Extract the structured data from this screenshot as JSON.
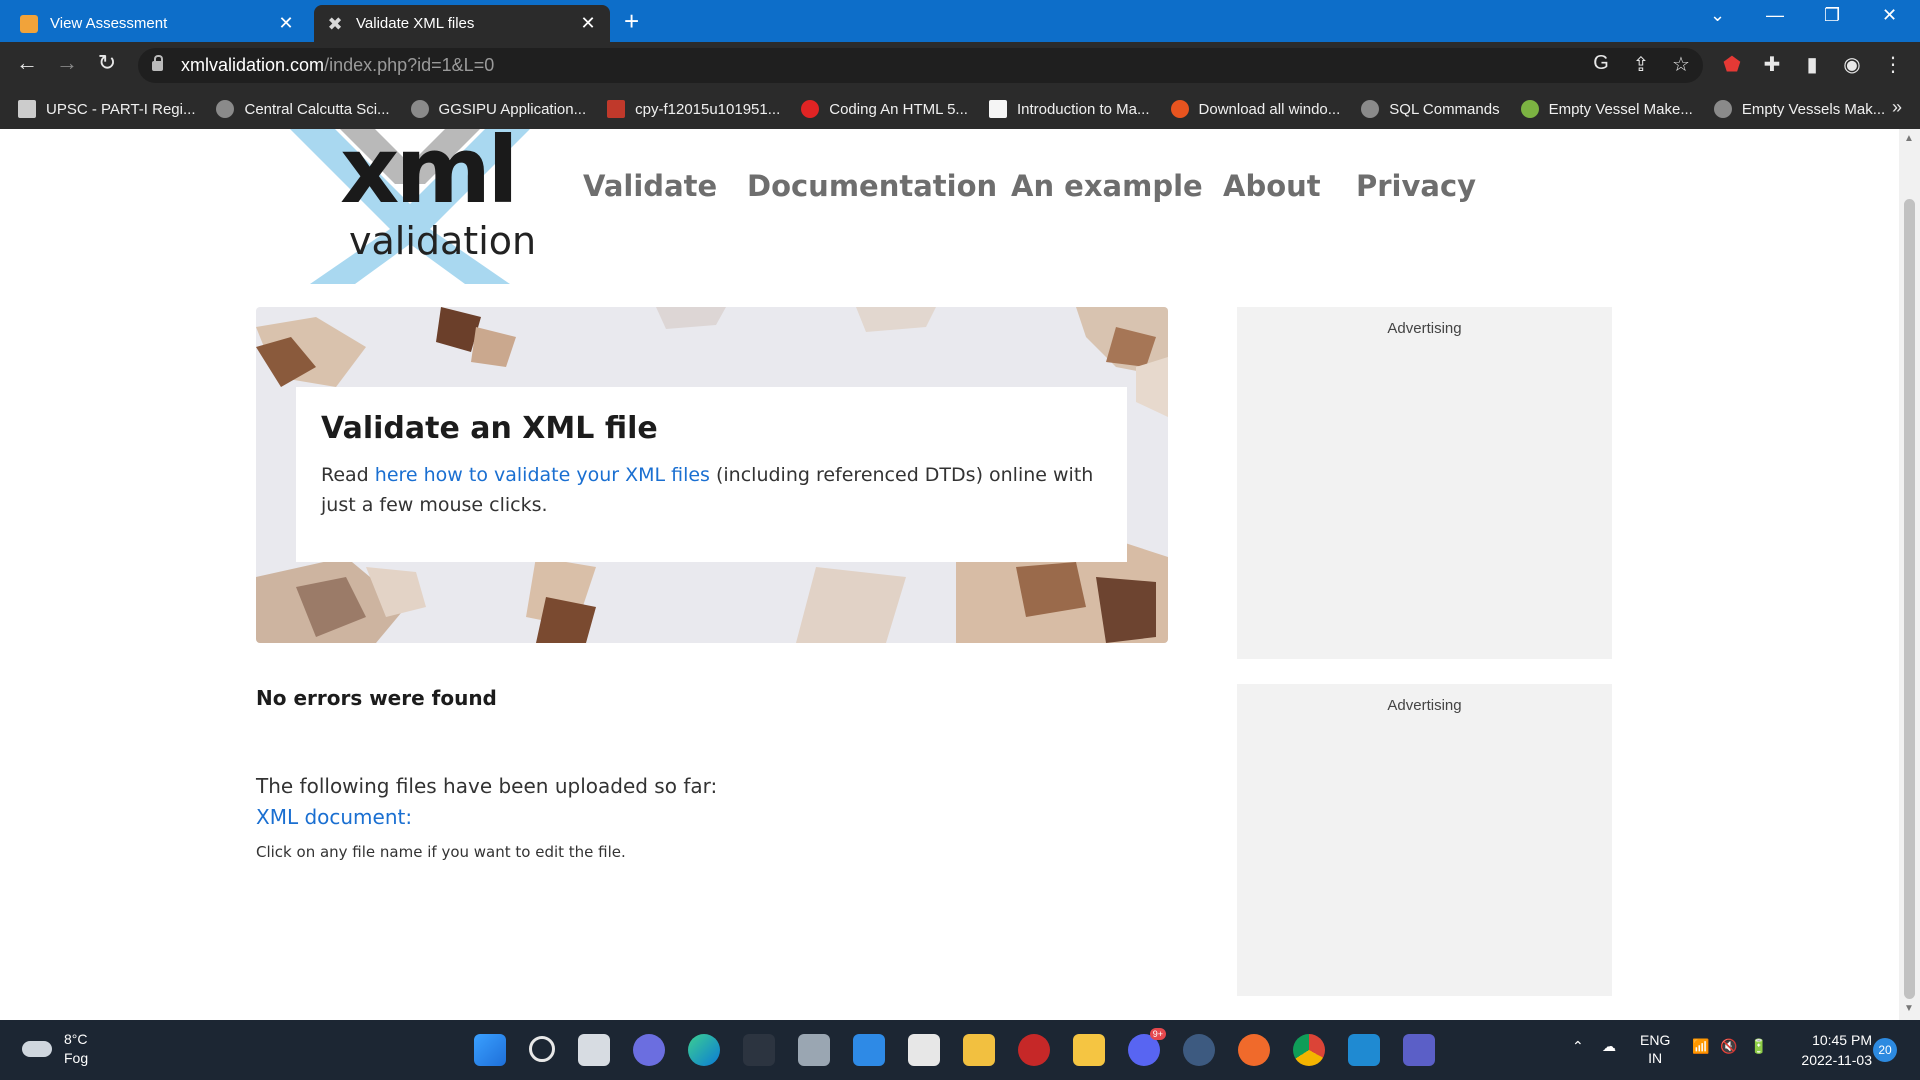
{
  "browser": {
    "tabs": [
      {
        "title": "View Assessment",
        "active": false
      },
      {
        "title": "Validate XML files",
        "active": true
      }
    ],
    "url_host": "xmlvalidation.com",
    "url_path": "/index.php?id=1&L=0",
    "bookmarks": [
      "UPSC - PART-I Regi...",
      "Central Calcutta Sci...",
      "GGSIPU Application...",
      "cpy-f12015u101951...",
      "Coding An HTML 5...",
      "Introduction to Ma...",
      "Download all windo...",
      "SQL Commands",
      "Empty Vessel Make...",
      "Empty Vessels Mak..."
    ]
  },
  "site": {
    "logo_word": "xml",
    "logo_sub": "validation",
    "nav": [
      "Validate",
      "Documentation",
      "An example",
      "About",
      "Privacy"
    ]
  },
  "hero": {
    "title": "Validate an XML file",
    "text_before": "Read ",
    "link_text": "here how to validate your XML files",
    "text_after": " (including referenced DTDs) online with just a few mouse clicks."
  },
  "ads": {
    "label": "Advertising"
  },
  "result": {
    "status": "No errors were found",
    "uploaded_intro": "The following files have been uploaded so far:",
    "file_link": "XML document:",
    "hint": "Click on any file name if you want to edit the file."
  },
  "taskbar": {
    "temperature": "8°C",
    "condition": "Fog",
    "lang_top": "ENG",
    "lang_bottom": "IN",
    "time": "10:45 PM",
    "date": "2022-11-03",
    "notifications": "20",
    "discord_badge": "9+"
  },
  "colors": {
    "tabbar": "#0d6ec9",
    "toolbar": "#2b2b2b",
    "link": "#1a6fd1",
    "nav_text": "#6e6e6e",
    "logo_blue": "#a9d8f0",
    "taskbar": "#1c2633"
  }
}
